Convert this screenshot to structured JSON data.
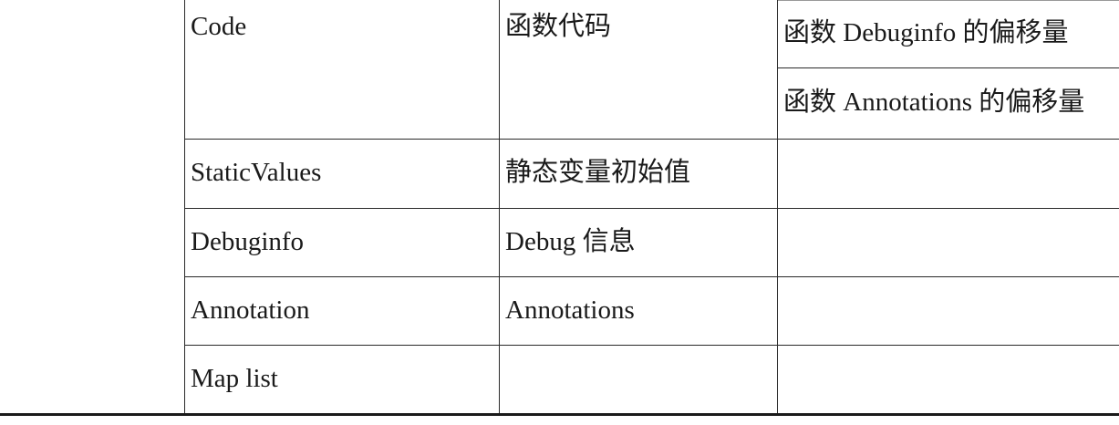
{
  "table": {
    "rows": [
      {
        "name": "Code",
        "desc": "函数代码",
        "extra": [
          "函数 Debuginfo 的偏移量",
          "函数 Annotations 的偏移量"
        ]
      },
      {
        "name": "StaticValues",
        "desc": "静态变量初始值",
        "extra": [
          ""
        ]
      },
      {
        "name": "Debuginfo",
        "desc": "Debug 信息",
        "extra": [
          ""
        ]
      },
      {
        "name": "Annotation",
        "desc": "Annotations",
        "extra": [
          ""
        ]
      },
      {
        "name": "Map list",
        "desc": "",
        "extra": [
          ""
        ]
      }
    ]
  }
}
